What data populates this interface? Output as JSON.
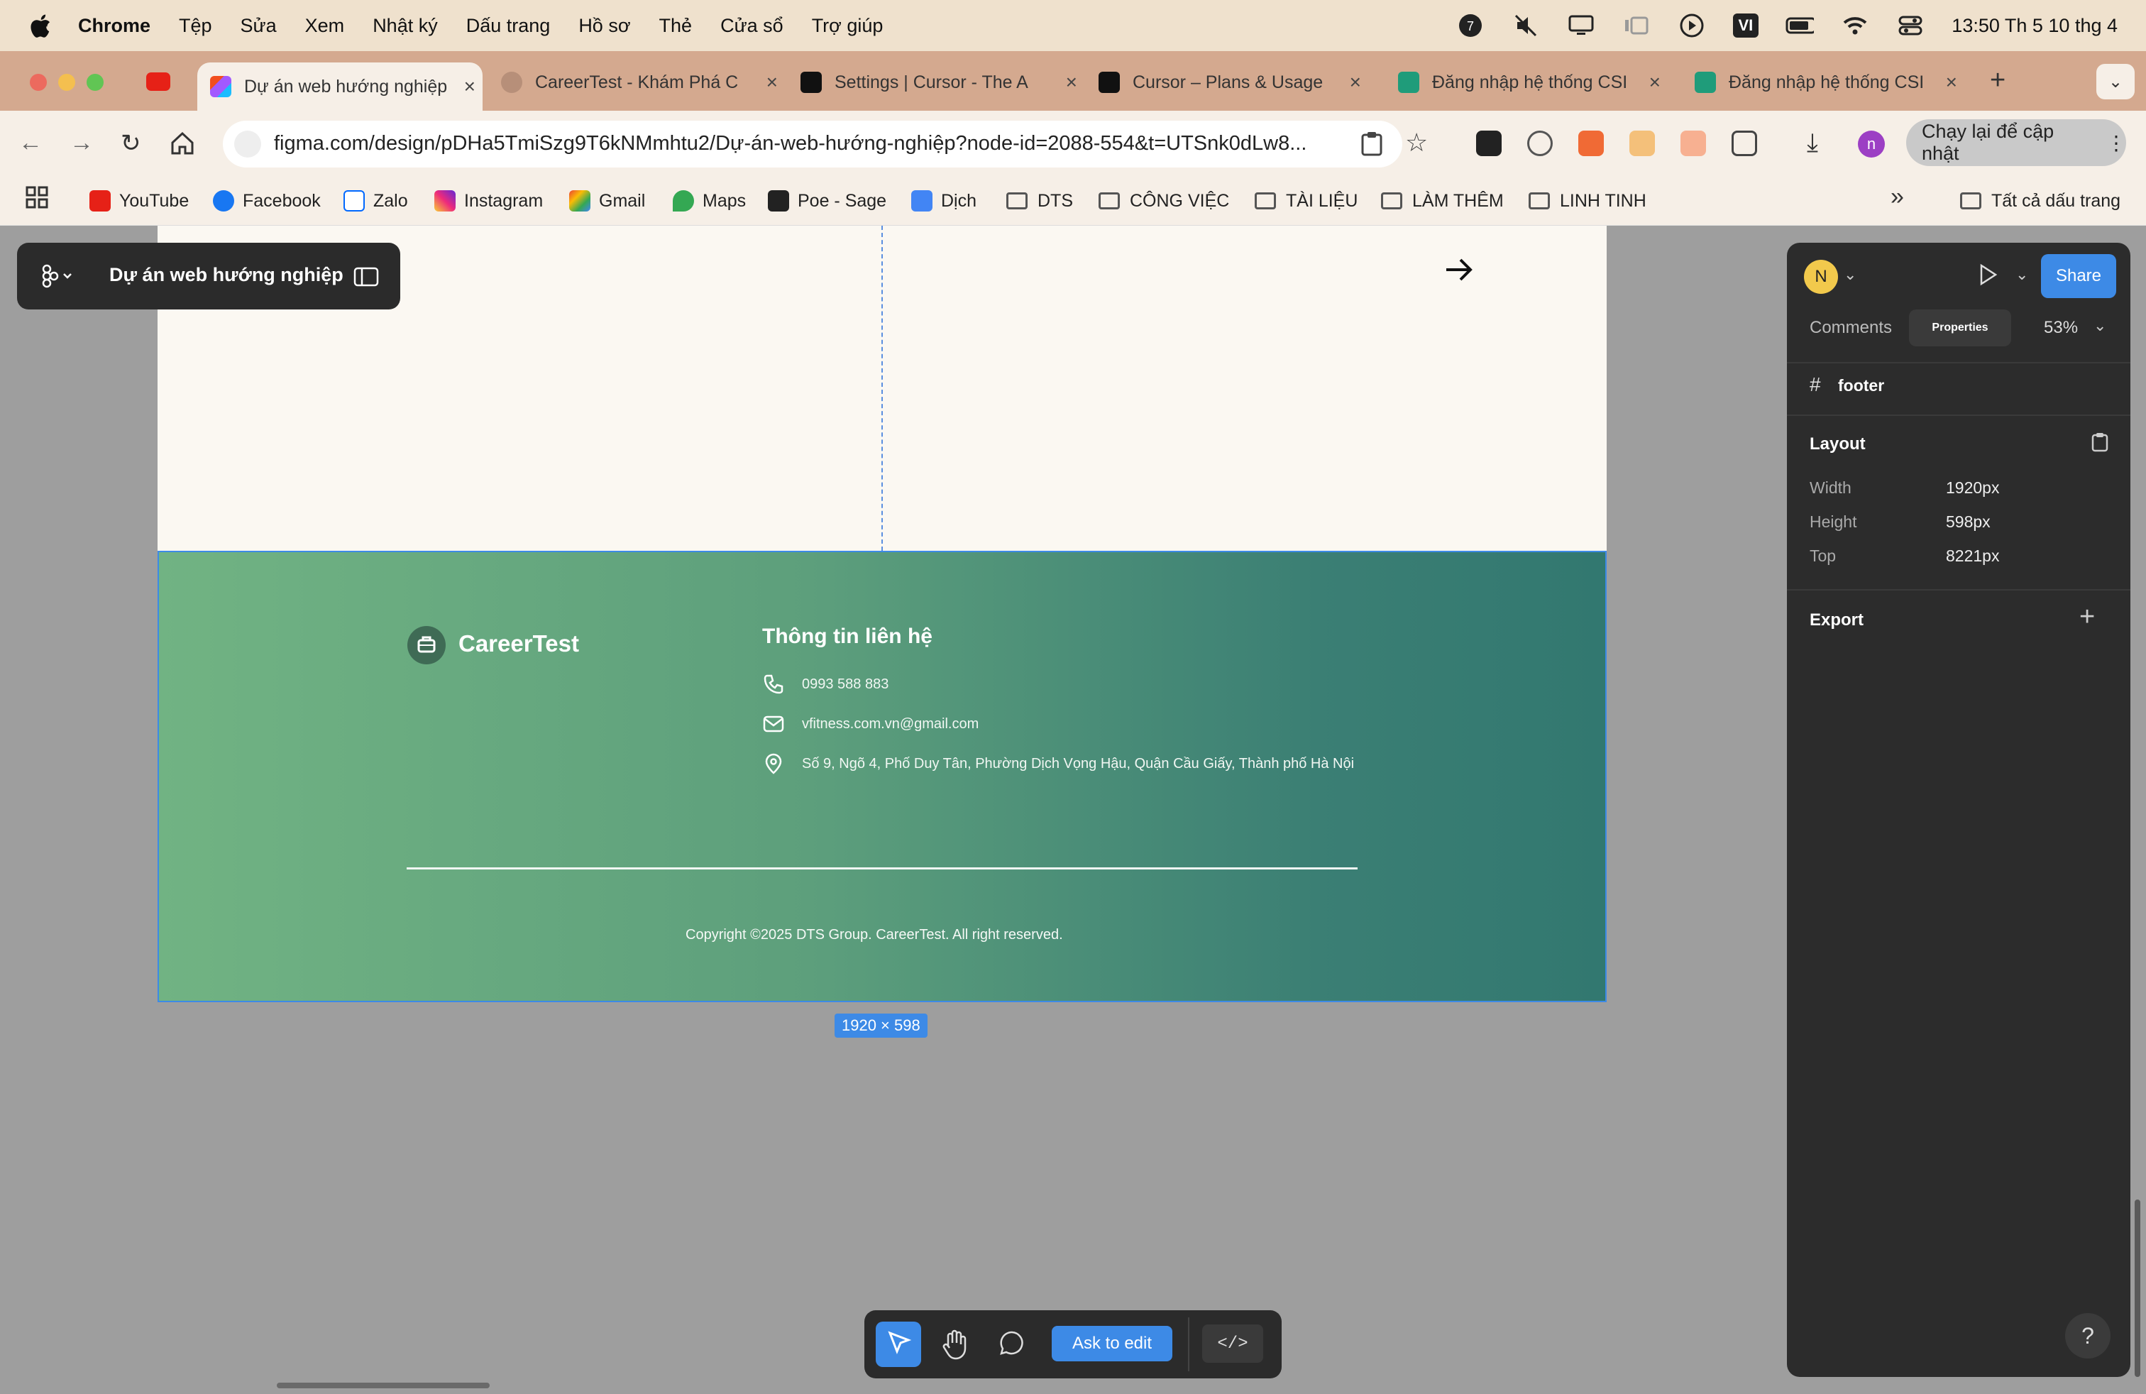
{
  "menubar": {
    "app": "Chrome",
    "items": [
      "Tệp",
      "Sửa",
      "Xem",
      "Nhật ký",
      "Dấu trang",
      "Hồ sơ",
      "Thẻ",
      "Cửa sổ",
      "Trợ giúp"
    ],
    "input_indicator": "VI",
    "clock": "13:50 Th 5 10 thg 4"
  },
  "tabs": [
    {
      "label": "Dự án web hướng nghiệp",
      "active": true
    },
    {
      "label": "CareerTest - Khám Phá C",
      "active": false
    },
    {
      "label": "Settings | Cursor - The A",
      "active": false
    },
    {
      "label": "Cursor – Plans & Usage",
      "active": false
    },
    {
      "label": "Đăng nhập hệ thống CSI",
      "active": false
    },
    {
      "label": "Đăng nhập hệ thống CSI",
      "active": false
    }
  ],
  "address_bar": {
    "url": "figma.com/design/pDHa5TmiSzg9T6kNMmhtu2/Dự-án-web-hướng-nghiệp?node-id=2088-554&t=UTSnk0dLw8...",
    "update_button": "Chạy lại để cập nhật"
  },
  "bookmarks": {
    "items": [
      "YouTube",
      "Facebook",
      "Zalo",
      "Instagram",
      "Gmail",
      "Maps",
      "Poe - Sage",
      "Dịch"
    ],
    "folders": [
      "DTS",
      "CÔNG VIỆC",
      "TÀI LIỆU",
      "LÀM THÊM",
      "LINH TINH"
    ],
    "all_bookmarks": "Tất cả dấu trang"
  },
  "figma": {
    "file_name": "Dự án web hướng nghiệp",
    "selection_size": "1920 × 598",
    "footer": {
      "brand": "CareerTest",
      "contact_title": "Thông tin liên hệ",
      "phone": "0993 588 883",
      "email": "vfitness.com.vn@gmail.com",
      "address": "Số 9, Ngõ 4, Phố Duy Tân, Phường Dịch Vọng Hậu, Quận Cầu Giấy, Thành phố Hà Nội",
      "copyright": "Copyright ©2025 DTS Group. CareerTest. All right reserved."
    },
    "panel": {
      "avatar": "N",
      "share": "Share",
      "tabs": [
        "Comments",
        "Properties"
      ],
      "zoom": "53%",
      "layer_name": "footer",
      "layout_title": "Layout",
      "width_label": "Width",
      "width_value": "1920px",
      "height_label": "Height",
      "height_value": "598px",
      "top_label": "Top",
      "top_value": "8221px",
      "export_title": "Export"
    },
    "toolbar": {
      "ask_to_edit": "Ask to edit"
    }
  },
  "colors": {
    "accent": "#3d8ae6",
    "footer_gradient_start": "#71b383",
    "footer_gradient_end": "#327870",
    "menubar": "#efe1cd",
    "tabstrip": "#d4a98f"
  }
}
